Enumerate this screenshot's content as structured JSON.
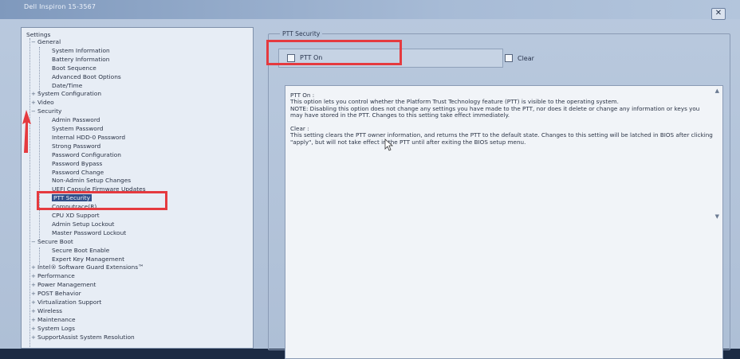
{
  "window": {
    "title": "Dell Inspiron 15-3567",
    "close_symbol": "✕"
  },
  "tree": {
    "root": "Settings",
    "items": [
      {
        "label": "General",
        "level": 1,
        "expander": "−"
      },
      {
        "label": "System Information",
        "level": 2
      },
      {
        "label": "Battery Information",
        "level": 2
      },
      {
        "label": "Boot Sequence",
        "level": 2
      },
      {
        "label": "Advanced Boot Options",
        "level": 2
      },
      {
        "label": "Date/Time",
        "level": 2
      },
      {
        "label": "System Configuration",
        "level": 1,
        "expander": "+"
      },
      {
        "label": "Video",
        "level": 1,
        "expander": "+"
      },
      {
        "label": "Security",
        "level": 1,
        "expander": "−"
      },
      {
        "label": "Admin Password",
        "level": 2
      },
      {
        "label": "System Password",
        "level": 2
      },
      {
        "label": "Internal HDD-0 Password",
        "level": 2
      },
      {
        "label": "Strong Password",
        "level": 2
      },
      {
        "label": "Password Configuration",
        "level": 2
      },
      {
        "label": "Password Bypass",
        "level": 2
      },
      {
        "label": "Password Change",
        "level": 2
      },
      {
        "label": "Non-Admin Setup Changes",
        "level": 2
      },
      {
        "label": "UEFI Capsule Firmware Updates",
        "level": 2
      },
      {
        "label": "PTT Security",
        "level": 2,
        "selected": true
      },
      {
        "label": "Computrace(R)",
        "level": 2
      },
      {
        "label": "CPU XD Support",
        "level": 2
      },
      {
        "label": "Admin Setup Lockout",
        "level": 2
      },
      {
        "label": "Master Password Lockout",
        "level": 2
      },
      {
        "label": "Secure Boot",
        "level": 1,
        "expander": "−"
      },
      {
        "label": "Secure Boot Enable",
        "level": 2
      },
      {
        "label": "Expert Key Management",
        "level": 2
      },
      {
        "label": "Intel® Software Guard Extensions™",
        "level": 1,
        "expander": "+"
      },
      {
        "label": "Performance",
        "level": 1,
        "expander": "+"
      },
      {
        "label": "Power Management",
        "level": 1,
        "expander": "+"
      },
      {
        "label": "POST Behavior",
        "level": 1,
        "expander": "+"
      },
      {
        "label": "Virtualization Support",
        "level": 1,
        "expander": "+"
      },
      {
        "label": "Wireless",
        "level": 1,
        "expander": "+"
      },
      {
        "label": "Maintenance",
        "level": 1,
        "expander": "+"
      },
      {
        "label": "System Logs",
        "level": 1,
        "expander": "+"
      },
      {
        "label": "SupportAssist System Resolution",
        "level": 1,
        "expander": "+"
      }
    ]
  },
  "panel": {
    "group_title": "PTT Security",
    "ptt_on_label": "PTT On",
    "clear_label": "Clear",
    "description": "PTT On :\nThis option lets you control whether the Platform Trust Technology feature (PTT) is visible to the operating system.\nNOTE: Disabling this option does not change any settings you have made to the PTT, nor does it delete or change any information or keys you may have stored in the PTT. Changes to this setting take effect immediately.\n\nClear :\nThis setting clears the PTT owner information, and returns the PTT to the default state. Changes to this setting will be latched in BIOS after clicking \"apply\", but will not take effect in the PTT until after exiting the BIOS setup menu."
  },
  "colors": {
    "annotation_red": "#e53a3f",
    "selection": "#32508a"
  }
}
